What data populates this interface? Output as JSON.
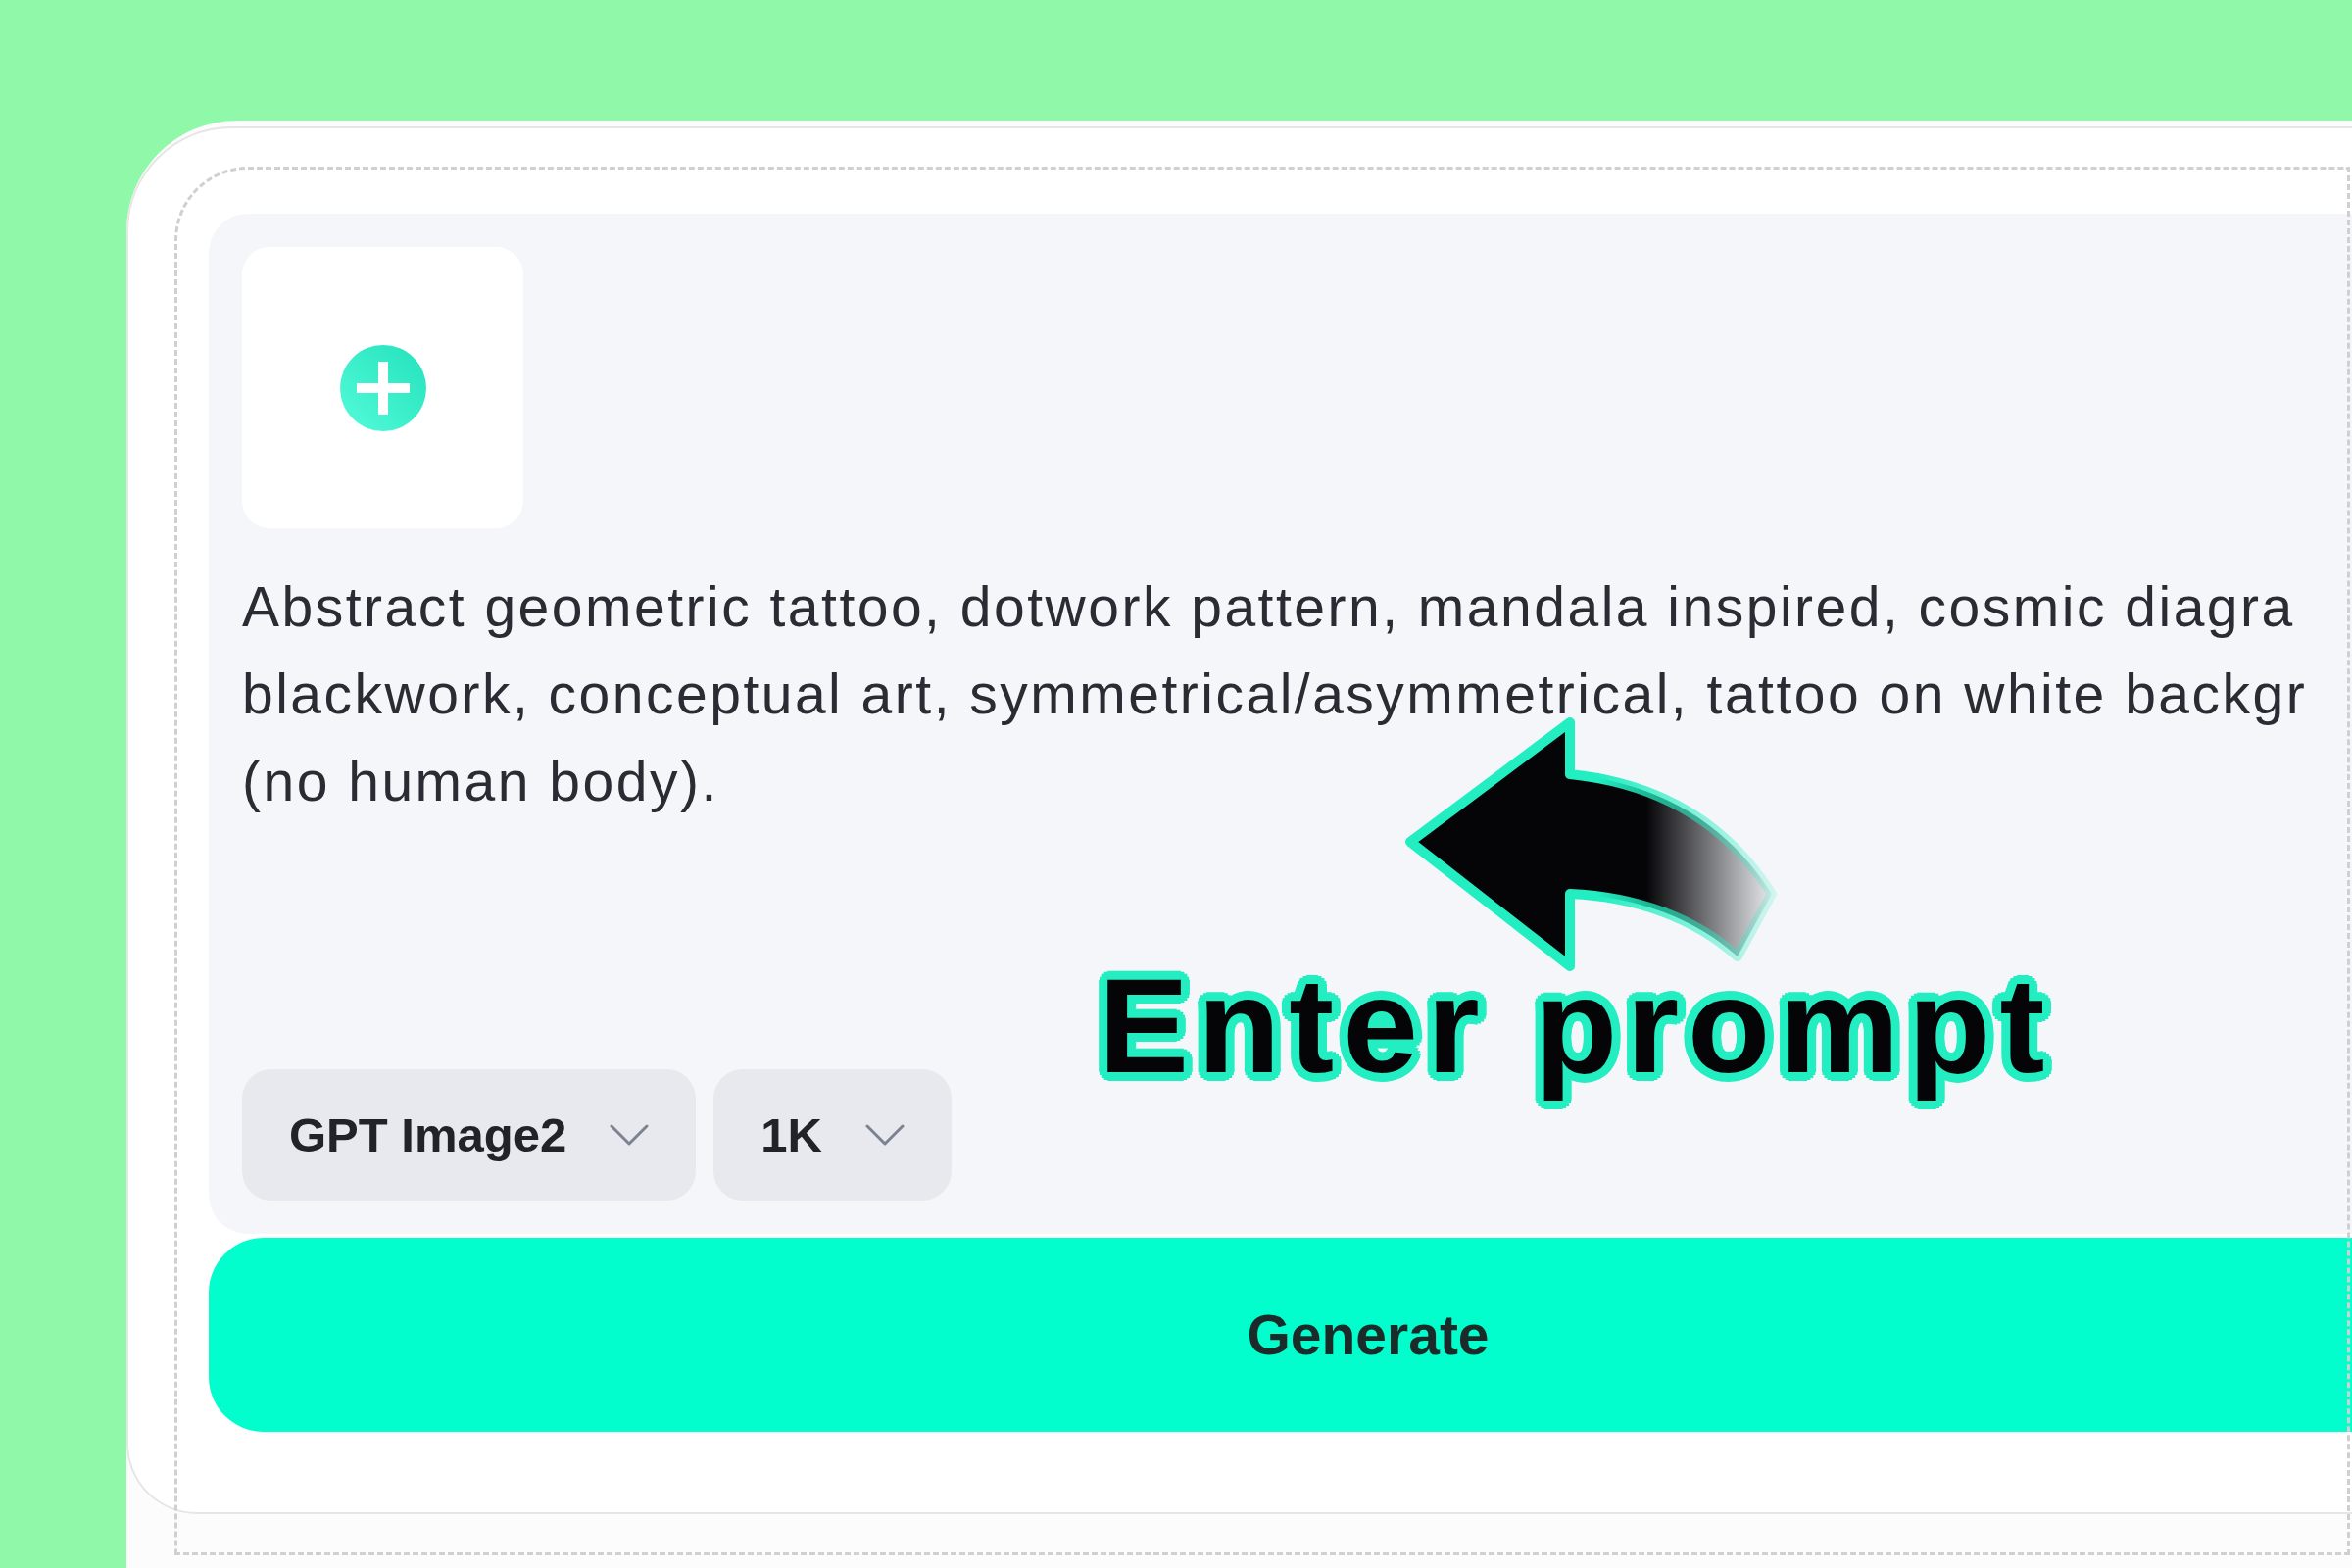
{
  "prompt": {
    "value": "Abstract geometric tattoo, dotwork pattern, mandala inspired, cosmic diagra\nblackwork, conceptual art, symmetrical/asymmetrical, tattoo on white backgr\n(no human body)."
  },
  "options": [
    {
      "label": "GPT Image2"
    },
    {
      "label": "1K"
    }
  ],
  "generate_button": {
    "label": "Generate"
  },
  "annotation": {
    "label": "Enter prompt"
  }
}
